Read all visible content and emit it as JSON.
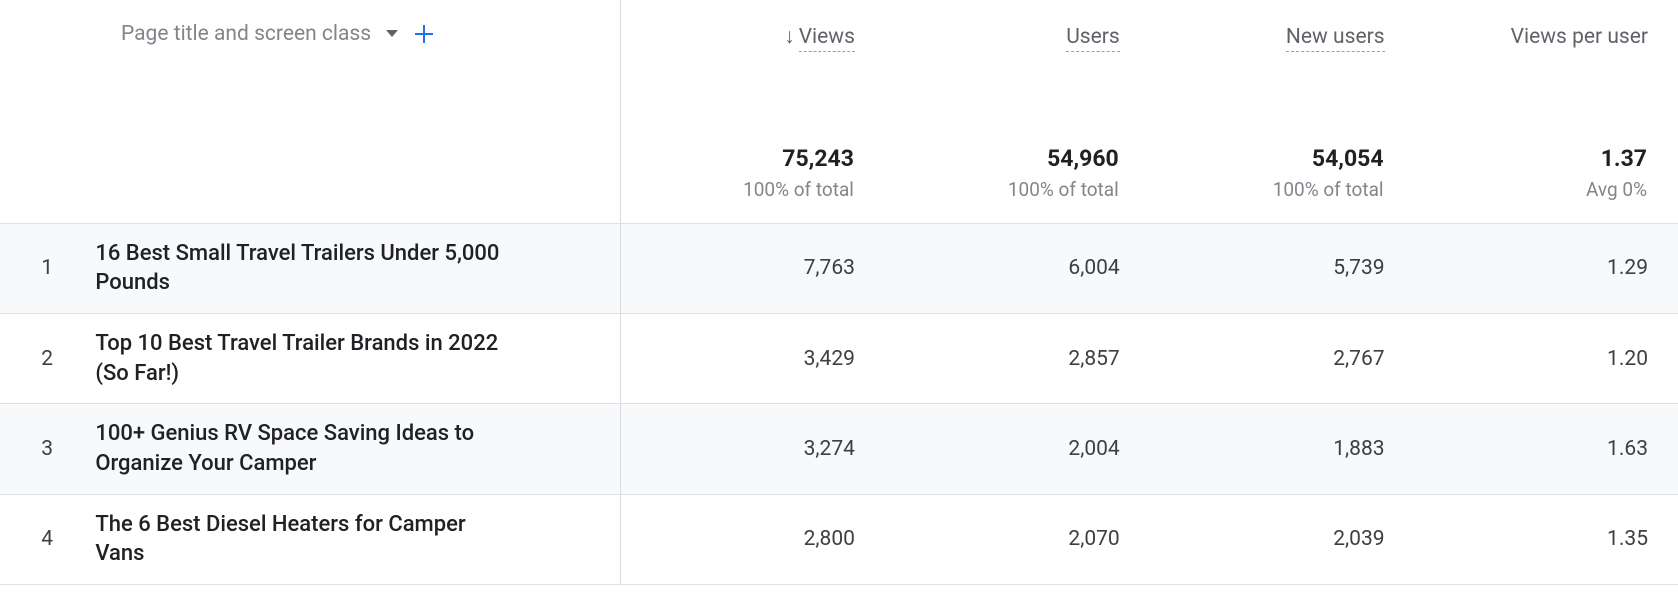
{
  "header": {
    "dimension_label": "Page title and screen class",
    "metrics": [
      {
        "name": "Views",
        "sorted": true
      },
      {
        "name": "Users"
      },
      {
        "name": "New users"
      },
      {
        "name": "Views per user",
        "no_underline": true
      }
    ]
  },
  "totals": {
    "values": [
      "75,243",
      "54,960",
      "54,054",
      "1.37"
    ],
    "subs": [
      "100% of total",
      "100% of total",
      "100% of total",
      "Avg 0%"
    ]
  },
  "rows": [
    {
      "idx": "1",
      "title": "16 Best Small Travel Trailers Under 5,000 Pounds",
      "values": [
        "7,763",
        "6,004",
        "5,739",
        "1.29"
      ]
    },
    {
      "idx": "2",
      "title": "Top 10 Best Travel Trailer Brands in 2022 (So Far!)",
      "values": [
        "3,429",
        "2,857",
        "2,767",
        "1.20"
      ]
    },
    {
      "idx": "3",
      "title": "100+ Genius RV Space Saving Ideas to Organize Your Camper",
      "values": [
        "3,274",
        "2,004",
        "1,883",
        "1.63"
      ]
    },
    {
      "idx": "4",
      "title": "The 6 Best Diesel Heaters for Camper Vans",
      "values": [
        "2,800",
        "2,070",
        "2,039",
        "1.35"
      ]
    }
  ]
}
